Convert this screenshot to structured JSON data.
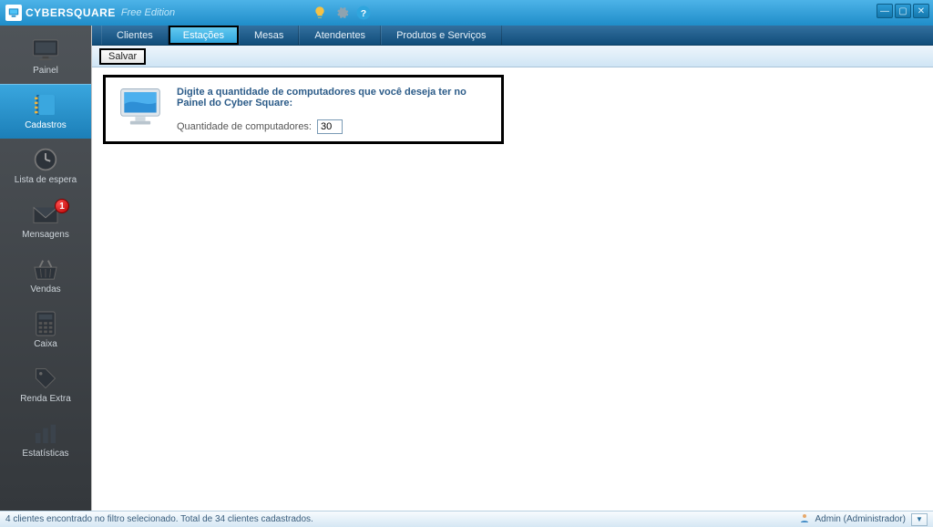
{
  "app": {
    "name": "CYBERSQUARE",
    "edition": "Free Edition"
  },
  "sidebar": {
    "items": [
      {
        "label": "Painel"
      },
      {
        "label": "Cadastros"
      },
      {
        "label": "Lista de espera"
      },
      {
        "label": "Mensagens",
        "badge": "1"
      },
      {
        "label": "Vendas"
      },
      {
        "label": "Caixa"
      },
      {
        "label": "Renda Extra"
      },
      {
        "label": "Estatísticas"
      }
    ]
  },
  "tabs": [
    {
      "label": "Clientes"
    },
    {
      "label": "Estações"
    },
    {
      "label": "Mesas"
    },
    {
      "label": "Atendentes"
    },
    {
      "label": "Produtos e Serviços"
    }
  ],
  "toolbar": {
    "save_label": "Salvar"
  },
  "panel": {
    "prompt": "Digite a quantidade de computadores que você deseja ter no Painel do Cyber Square:",
    "field_label": "Quantidade de computadores:",
    "field_value": "30"
  },
  "statusbar": {
    "left": "4 clientes encontrado no filtro selecionado. Total de 34 clientes cadastrados.",
    "user": "Admin (Administrador)"
  },
  "colors": {
    "accent": "#2fa5dd",
    "header": "#1f8dc9"
  }
}
